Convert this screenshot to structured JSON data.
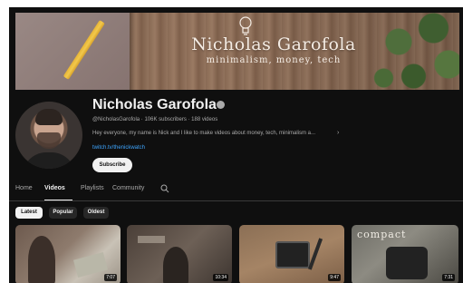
{
  "banner": {
    "title": "Nicholas Garofola",
    "subtitle": "minimalism, money, tech"
  },
  "channel": {
    "name": "Nicholas Garofola",
    "handle": "@NicholasGarofola",
    "subscribers": "106K subscribers",
    "videos": "188 videos",
    "description": "Hey everyone, my name is Nick and I like to make videos about money, tech, minimalism a...",
    "link": "twitch.tv/thenickwatch",
    "subscribe_label": "Subscribe"
  },
  "tabs": [
    {
      "label": "Home",
      "active": false
    },
    {
      "label": "Videos",
      "active": true
    },
    {
      "label": "Playlists",
      "active": false
    },
    {
      "label": "Community",
      "active": false
    }
  ],
  "chips": [
    {
      "label": "Latest",
      "active": true
    },
    {
      "label": "Popular",
      "active": false
    },
    {
      "label": "Oldest",
      "active": false
    }
  ],
  "videos": [
    {
      "duration": "7:07"
    },
    {
      "duration": "10:34"
    },
    {
      "duration": "9:47"
    },
    {
      "duration": "7:31",
      "overlay_text": "compact"
    }
  ],
  "colors": {
    "background": "#0f0f0f",
    "text_primary": "#f1f1f1",
    "text_secondary": "#aaaaaa",
    "link": "#3ea6ff"
  }
}
